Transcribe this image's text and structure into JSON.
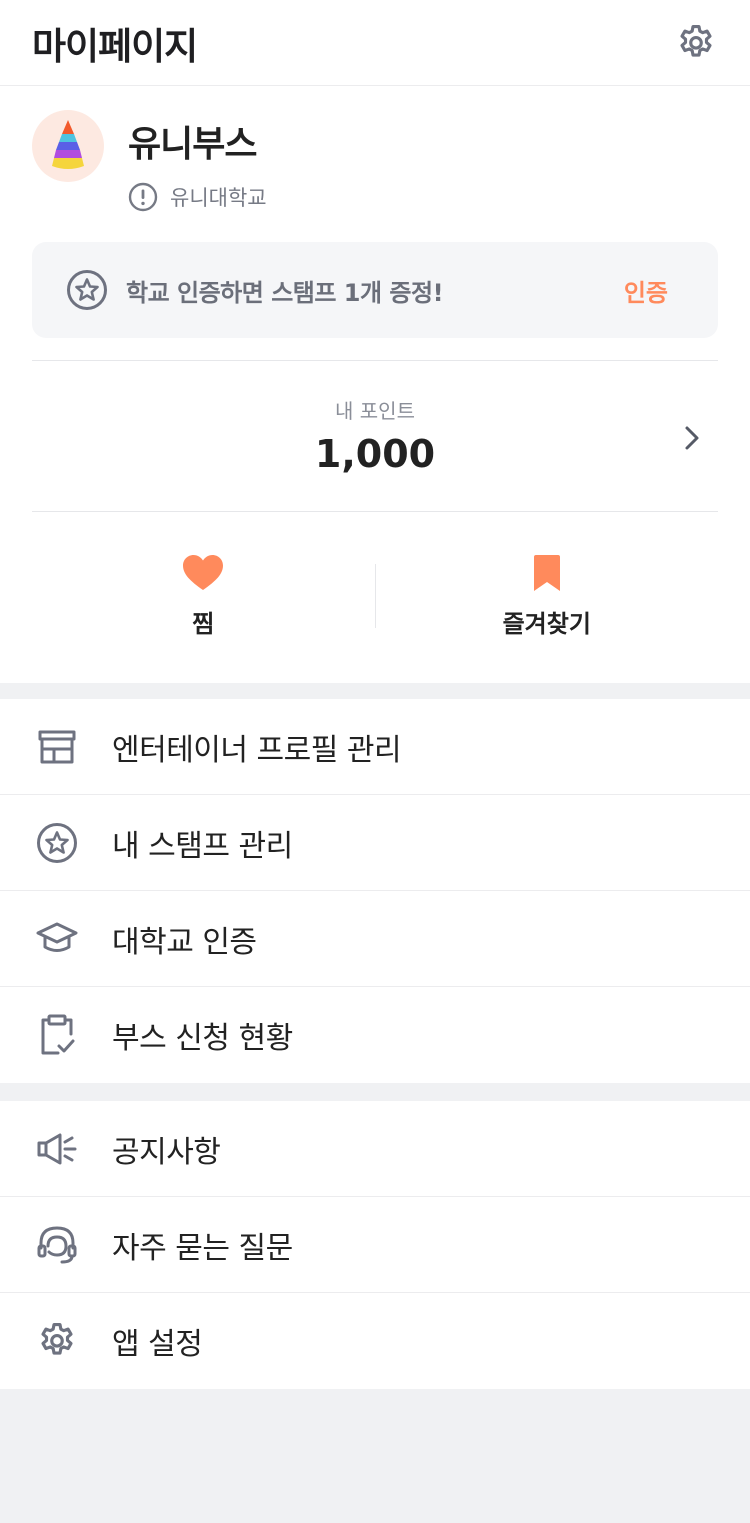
{
  "header": {
    "title": "마이페이지",
    "settings_icon": "gear-icon"
  },
  "profile": {
    "name": "유니부스",
    "school": "유니대학교",
    "avatar_icon": "party-hat-icon"
  },
  "verify_banner": {
    "text": "학교 인증하면 스탬프 1개 증정!",
    "button": "인증"
  },
  "points": {
    "label": "내 포인트",
    "value": "1,000"
  },
  "quick_actions": [
    {
      "label": "찜",
      "icon": "heart-icon"
    },
    {
      "label": "즐겨찾기",
      "icon": "bookmark-icon"
    }
  ],
  "menu_primary": [
    {
      "label": "엔터테이너 프로필 관리",
      "icon": "store-icon"
    },
    {
      "label": "내 스탬프 관리",
      "icon": "star-badge-icon"
    },
    {
      "label": "대학교 인증",
      "icon": "graduation-cap-icon"
    },
    {
      "label": "부스 신청 현황",
      "icon": "clipboard-check-icon"
    }
  ],
  "menu_secondary": [
    {
      "label": "공지사항",
      "icon": "megaphone-icon"
    },
    {
      "label": "자주 묻는 질문",
      "icon": "headset-icon"
    },
    {
      "label": "앱 설정",
      "icon": "gear-icon"
    }
  ],
  "colors": {
    "accent": "#ff8a5c",
    "icon_gray": "#6e7280",
    "background": "#f0f1f3"
  }
}
